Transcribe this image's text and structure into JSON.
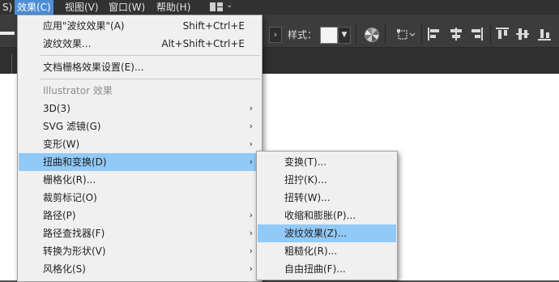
{
  "menubar": {
    "items": [
      {
        "label": "S)"
      },
      {
        "label": "效果(C)"
      },
      {
        "label": "视图(V)"
      },
      {
        "label": "窗口(W)"
      },
      {
        "label": "帮助(H)"
      }
    ],
    "workspace_icon": "workspace-grid-icon"
  },
  "control_bar": {
    "style_label": "样式："
  },
  "effect_menu": {
    "items": [
      {
        "label": "应用\"波纹效果\"(A)",
        "shortcut": "Shift+Ctrl+E"
      },
      {
        "label": "波纹效果...",
        "shortcut": "Alt+Shift+Ctrl+E"
      },
      {
        "label": "文档栅格效果设置(E)..."
      },
      {
        "label": "Illustrator 效果"
      },
      {
        "label": "3D(3)",
        "arrow": "›"
      },
      {
        "label": "SVG 滤镜(G)",
        "arrow": "›"
      },
      {
        "label": "变形(W)",
        "arrow": "›"
      },
      {
        "label": "扭曲和变换(D)",
        "arrow": "›"
      },
      {
        "label": "栅格化(R)..."
      },
      {
        "label": "裁剪标记(O)"
      },
      {
        "label": "路径(P)",
        "arrow": "›"
      },
      {
        "label": "路径查找器(F)",
        "arrow": "›"
      },
      {
        "label": "转换为形状(V)",
        "arrow": "›"
      },
      {
        "label": "风格化(S)",
        "arrow": "›"
      }
    ]
  },
  "distort_submenu": {
    "items": [
      {
        "label": "变换(T)..."
      },
      {
        "label": "扭拧(K)..."
      },
      {
        "label": "扭转(W)..."
      },
      {
        "label": "收缩和膨胀(P)..."
      },
      {
        "label": "波纹效果(Z)..."
      },
      {
        "label": "粗糙化(R)..."
      },
      {
        "label": "自由扭曲(F)..."
      }
    ]
  },
  "colors": {
    "menubar_bg": "#323232",
    "active_menu_bg": "#4d8ed6",
    "menu_bg": "#f0f0f0",
    "menu_highlight": "#91c9f7",
    "disabled_text": "#8c8c8c"
  }
}
